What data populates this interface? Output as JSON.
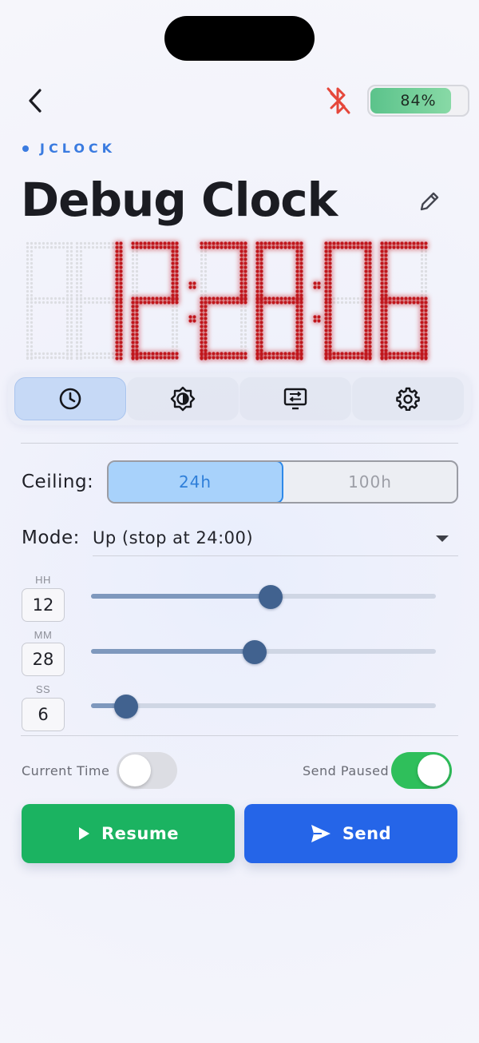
{
  "header": {
    "battery_percent": 84,
    "battery_label": "84%",
    "bluetooth_status": "disconnected",
    "bluetooth_color": "#e5473b"
  },
  "brand": "JCLOCK",
  "title": "Debug Clock",
  "display": {
    "time_text": "12:28:06",
    "color": "#c0161b"
  },
  "tabs": [
    {
      "icon": "clock-icon",
      "active": true
    },
    {
      "icon": "brightness-icon",
      "active": false
    },
    {
      "icon": "display-swap-icon",
      "active": false
    },
    {
      "icon": "gear-icon",
      "active": false
    }
  ],
  "ceiling": {
    "label": "Ceiling:",
    "options": [
      "24h",
      "100h"
    ],
    "selected": "24h"
  },
  "mode": {
    "label": "Mode:",
    "value": "Up (stop at 24:00)"
  },
  "time_inputs": {
    "hours": {
      "label": "HH",
      "value": "12",
      "max": 23
    },
    "minutes": {
      "label": "MM",
      "value": "28",
      "max": 59
    },
    "seconds": {
      "label": "SS",
      "value": "6",
      "max": 59
    }
  },
  "toggles": {
    "current_time": {
      "label": "Current Time",
      "on": false
    },
    "send_paused": {
      "label": "Send Paused",
      "on": true
    }
  },
  "buttons": {
    "resume_label": "Resume",
    "send_label": "Send"
  },
  "colors": {
    "accent": "#3a7be0",
    "resume": "#1bb361",
    "send": "#2565e8",
    "toggle_on": "#2fbf5b"
  }
}
